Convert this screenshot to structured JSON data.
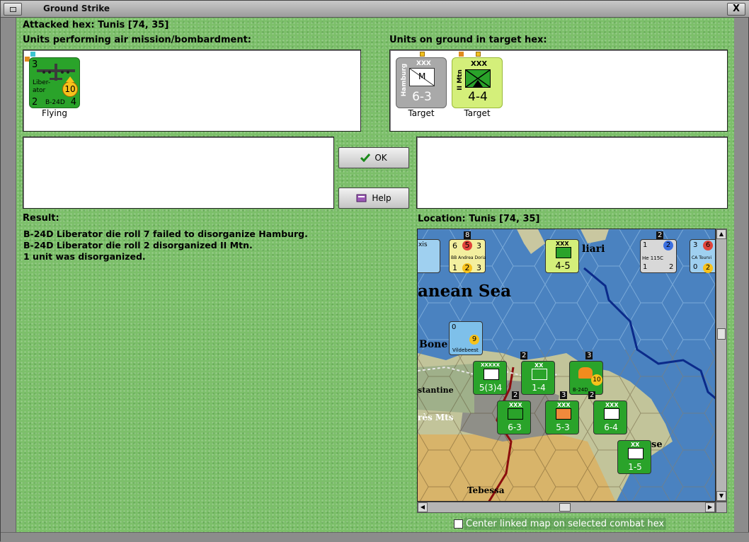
{
  "window": {
    "title": "Ground Strike",
    "close_glyph": "X"
  },
  "header": {
    "attacked_hex": "Attacked hex: Tunis  [74, 35]"
  },
  "air_units": {
    "label": "Units performing air mission/bombardment:",
    "units": [
      {
        "top_left": "3",
        "name_line1": "Liber-",
        "name_line2": "ator",
        "model": "B-24D",
        "strength": "10",
        "bottom_left": "2",
        "bottom_right": "4",
        "status": "Flying",
        "color": "#2aa32a"
      }
    ]
  },
  "ground_units": {
    "label": "Units on ground in target hex:",
    "units": [
      {
        "side_text": "Hamburg",
        "size": "XXX",
        "type_letter": "M",
        "value": "6-3",
        "status": "Target",
        "color": "#a9a9a9"
      },
      {
        "side_text": "II Mtn",
        "size": "XXX",
        "value": "4-4",
        "status": "Target",
        "color": "#d4ef7a"
      }
    ]
  },
  "buttons": {
    "ok": "OK",
    "help": "Help"
  },
  "result": {
    "label": "Result:",
    "lines": [
      "B-24D Liberator die roll 7 failed to disorganize Hamburg.",
      "B-24D Liberator die roll 2 disorganized II Mtn.",
      "1 unit was disorganized."
    ]
  },
  "location": {
    "label": "Location:  Tunis  [74, 35]"
  },
  "map": {
    "place_names": [
      "anean Sea",
      "liari",
      "Bone",
      "stantine",
      "rès Mts",
      "se",
      "Tebessa"
    ],
    "counters": [
      {
        "label": "4-5",
        "top": "XXX",
        "color": "#d4ef7a"
      },
      {
        "label": "5(3)4",
        "top": "XXXXX",
        "color": "#2aa32a"
      },
      {
        "label": "1-4",
        "top": "XX",
        "color": "#2aa32a"
      },
      {
        "label": "6-3",
        "top": "XXX",
        "color": "#2aa32a"
      },
      {
        "label": "5-3",
        "top": "XXX",
        "color": "#2aa32a"
      },
      {
        "label": "6-4",
        "top": "XXX",
        "color": "#2aa32a"
      },
      {
        "label": "1-5",
        "top": "XX",
        "color": "#2aa32a"
      }
    ],
    "ship_counter": {
      "name": "BB Andrea Doria",
      "n1": "6",
      "n2": "5",
      "n3": "3",
      "b1": "1",
      "b2": "2",
      "b3": "3",
      "stack": "8"
    },
    "ship_counter2": {
      "name": "CA Tourvi",
      "n1": "3",
      "n2": "6",
      "b1": "0",
      "b2": "2"
    },
    "air_counter": {
      "name": "He 115C",
      "n1": "1",
      "n2": "2",
      "b1": "1",
      "b2": "2",
      "stack": "2"
    },
    "wildebeest": {
      "name": "Vildebeest",
      "top": "0",
      "value": "9"
    },
    "b24": {
      "model": "B-24D",
      "value": "10",
      "stack": "3"
    },
    "stack_numbers": [
      "2",
      "2",
      "3",
      "2"
    ],
    "side_text_top": "xis"
  },
  "footer": {
    "checkbox_label": "Center linked map on selected combat hex"
  },
  "colors": {
    "panel_green": "#7cbf6a",
    "unit_green": "#2aa32a",
    "hamburg_gray": "#a9a9a9",
    "mtn_lime": "#d4ef7a",
    "sea": "#4a82c0"
  }
}
